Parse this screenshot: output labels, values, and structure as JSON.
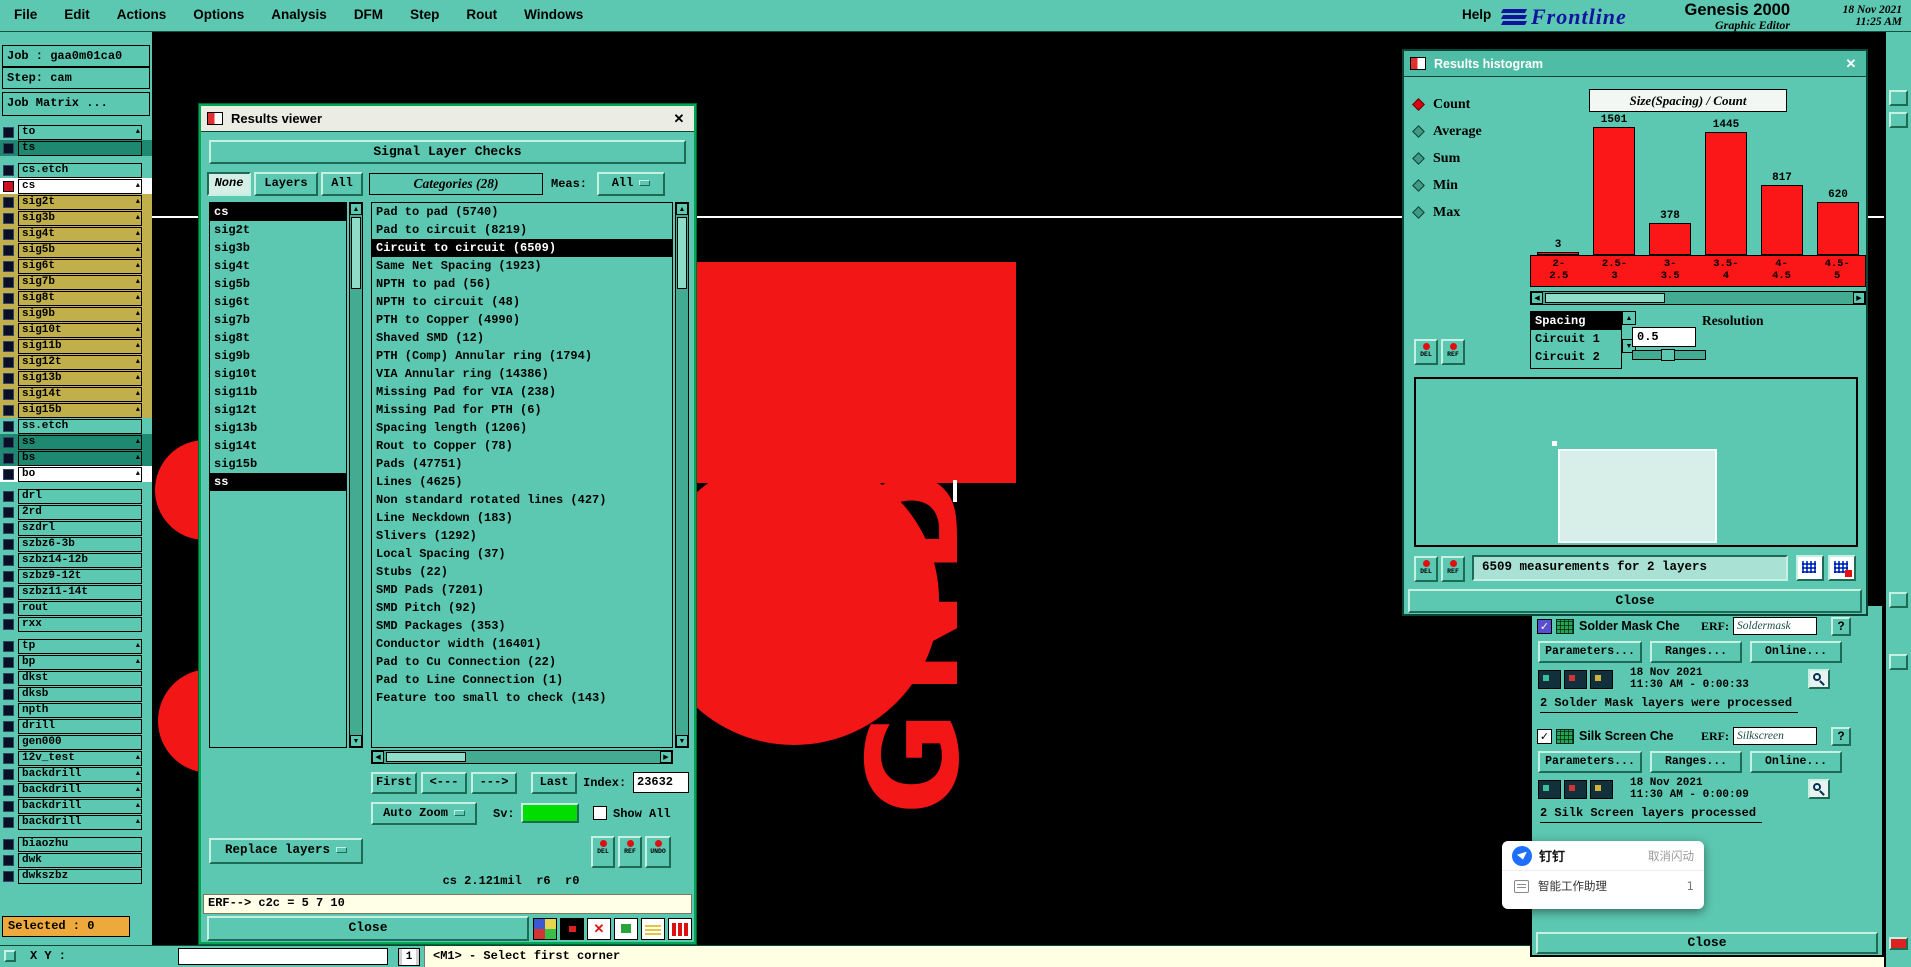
{
  "colors": {
    "teal": "#5cc8b1",
    "canvas_red": "#f31616",
    "yellow_row": "#c0af4b",
    "dark_row": "#1f8870",
    "orange_selected": "#eda93c",
    "swatch_green": "#00dd00",
    "brand_navy": "#12129e",
    "bar_red": "#fb1717"
  },
  "menu": {
    "items": [
      "File",
      "Edit",
      "Actions",
      "Options",
      "Analysis",
      "DFM",
      "Step",
      "Rout",
      "Windows"
    ],
    "help": "Help",
    "brand": "Frontline",
    "product": "Genesis 2000",
    "edition": "Graphic Editor",
    "date": "18 Nov 2021",
    "time": "11:25 AM"
  },
  "sidebar": {
    "job": "Job : gaa0m01ca0",
    "step": "Step: cam",
    "matrix_button": "Job Matrix ...",
    "selected": "Selected : 0",
    "layers": [
      {
        "name": "to",
        "bg": "teal",
        "arrow": true
      },
      {
        "name": "ts",
        "bg": "dark"
      },
      {
        "name": "cs.etch",
        "bg": "teal",
        "gap": true
      },
      {
        "name": "cs",
        "bg": "white",
        "arrow": true,
        "mark": "red"
      },
      {
        "name": "sig2t",
        "bg": "yellow",
        "arrow": true
      },
      {
        "name": "sig3b",
        "bg": "yellow",
        "arrow": true
      },
      {
        "name": "sig4t",
        "bg": "yellow",
        "arrow": true
      },
      {
        "name": "sig5b",
        "bg": "yellow",
        "arrow": true
      },
      {
        "name": "sig6t",
        "bg": "yellow",
        "arrow": true
      },
      {
        "name": "sig7b",
        "bg": "yellow",
        "arrow": true
      },
      {
        "name": "sig8t",
        "bg": "yellow",
        "arrow": true
      },
      {
        "name": "sig9b",
        "bg": "yellow",
        "arrow": true
      },
      {
        "name": "sig10t",
        "bg": "yellow",
        "arrow": true
      },
      {
        "name": "sig11b",
        "bg": "yellow",
        "arrow": true
      },
      {
        "name": "sig12t",
        "bg": "yellow",
        "arrow": true
      },
      {
        "name": "sig13b",
        "bg": "yellow",
        "arrow": true
      },
      {
        "name": "sig14t",
        "bg": "yellow",
        "arrow": true
      },
      {
        "name": "sig15b",
        "bg": "yellow",
        "arrow": true
      },
      {
        "name": "ss.etch",
        "bg": "teal"
      },
      {
        "name": "ss",
        "bg": "dark",
        "arrow": true
      },
      {
        "name": "bs",
        "bg": "dark",
        "arrow": true
      },
      {
        "name": "bo",
        "bg": "white",
        "arrow": true
      },
      {
        "name": "drl",
        "bg": "teal",
        "gap": true
      },
      {
        "name": "2rd",
        "bg": "teal"
      },
      {
        "name": "szdrl",
        "bg": "teal"
      },
      {
        "name": "szbz6-3b",
        "bg": "teal"
      },
      {
        "name": "szbz14-12b",
        "bg": "teal"
      },
      {
        "name": "szbz9-12t",
        "bg": "teal"
      },
      {
        "name": "szbz11-14t",
        "bg": "teal"
      },
      {
        "name": "rout",
        "bg": "teal"
      },
      {
        "name": "rxx",
        "bg": "teal"
      },
      {
        "name": "tp",
        "bg": "teal",
        "arrow": true,
        "gap": true
      },
      {
        "name": "bp",
        "bg": "teal",
        "arrow": true
      },
      {
        "name": "dkst",
        "bg": "teal"
      },
      {
        "name": "dksb",
        "bg": "teal"
      },
      {
        "name": "npth",
        "bg": "teal"
      },
      {
        "name": "drill",
        "bg": "teal"
      },
      {
        "name": "gen000",
        "bg": "teal"
      },
      {
        "name": "12v_test",
        "bg": "teal",
        "arrow": true
      },
      {
        "name": "backdrill",
        "bg": "teal",
        "arrow": true
      },
      {
        "name": "backdrill",
        "bg": "teal",
        "arrow": true
      },
      {
        "name": "backdrill",
        "bg": "teal",
        "arrow": true
      },
      {
        "name": "backdrill",
        "bg": "teal",
        "arrow": true
      },
      {
        "name": "biaozhu",
        "bg": "teal",
        "gap": true
      },
      {
        "name": "dwk",
        "bg": "teal"
      },
      {
        "name": "dwkszbz",
        "bg": "teal"
      }
    ]
  },
  "canvas": {
    "gnd_text": "GND"
  },
  "status_bar": {
    "xy_label": "X Y :",
    "layer_indicator": "1",
    "message": "<M1> - Select first corner"
  },
  "results_viewer": {
    "title": "Results viewer",
    "header": "Signal Layer Checks",
    "filter_none": "None",
    "filter_layers": "Layers",
    "filter_all": "All",
    "categories_label": "Categories (28)",
    "meas_label": "Meas:",
    "meas_value": "All",
    "layers": [
      {
        "name": "cs",
        "selected": true
      },
      {
        "name": "sig2t"
      },
      {
        "name": "sig3b"
      },
      {
        "name": "sig4t"
      },
      {
        "name": "sig5b"
      },
      {
        "name": "sig6t"
      },
      {
        "name": "sig7b"
      },
      {
        "name": "sig8t"
      },
      {
        "name": "sig9b"
      },
      {
        "name": "sig10t"
      },
      {
        "name": "sig11b"
      },
      {
        "name": "sig12t"
      },
      {
        "name": "sig13b"
      },
      {
        "name": "sig14t"
      },
      {
        "name": "sig15b"
      },
      {
        "name": "ss",
        "selected": true
      }
    ],
    "categories": [
      {
        "label": "Pad to pad (5740)"
      },
      {
        "label": "Pad to circuit (8219)"
      },
      {
        "label": "Circuit to circuit (6509)",
        "selected": true
      },
      {
        "label": "Same Net Spacing (1923)"
      },
      {
        "label": "NPTH to pad (56)"
      },
      {
        "label": "NPTH to circuit (48)"
      },
      {
        "label": "PTH to Copper (4990)"
      },
      {
        "label": "Shaved SMD (12)"
      },
      {
        "label": "PTH (Comp) Annular ring (1794)"
      },
      {
        "label": "VIA Annular ring (14386)"
      },
      {
        "label": "Missing Pad for VIA (238)"
      },
      {
        "label": "Missing Pad for PTH (6)"
      },
      {
        "label": "Spacing length (1206)"
      },
      {
        "label": "Rout to Copper (78)"
      },
      {
        "label": "Pads (47751)"
      },
      {
        "label": "Lines (4625)"
      },
      {
        "label": "Non standard rotated lines (427)"
      },
      {
        "label": "Line Neckdown (183)"
      },
      {
        "label": "Slivers (1292)"
      },
      {
        "label": "Local Spacing (37)"
      },
      {
        "label": "Stubs (22)"
      },
      {
        "label": "SMD Pads (7201)"
      },
      {
        "label": "SMD Pitch (92)"
      },
      {
        "label": "SMD Packages (353)"
      },
      {
        "label": "Conductor width (16401)"
      },
      {
        "label": "Pad to Cu Connection (22)"
      },
      {
        "label": "Pad to Line Connection (1)"
      },
      {
        "label": "Feature too small to check (143)"
      }
    ],
    "nav_first": "First",
    "nav_prev": "<---",
    "nav_next": "--->",
    "nav_last": "Last",
    "index_label": "Index:",
    "index_value": "23632",
    "auto_zoom": "Auto Zoom",
    "sv_label": "Sv:",
    "show_all": "Show All",
    "del": "DEL",
    "ref": "REF",
    "undo": "UNDO",
    "replace_layers": "Replace layers",
    "status_line": "cs 2.121mil  r6  r0",
    "erf_line": "ERF--> c2c = 5 7 10",
    "close": "Close"
  },
  "histogram": {
    "title": "Results histogram",
    "stats": [
      {
        "label": "Count",
        "selected": true
      },
      {
        "label": "Average"
      },
      {
        "label": "Sum"
      },
      {
        "label": "Min"
      },
      {
        "label": "Max"
      }
    ],
    "chart_data": {
      "type": "bar",
      "title": "Size(Spacing) / Count",
      "categories": [
        "2-\n2.5",
        "2.5-\n3",
        "3-\n3.5",
        "3.5-\n4",
        "4-\n4.5",
        "4.5-\n5"
      ],
      "values": [
        3,
        1501,
        378,
        1445,
        817,
        620
      ],
      "ylim": [
        0,
        1501
      ],
      "bar_color": "#fb1717",
      "band_color": "#fb1717"
    },
    "selector": [
      {
        "label": "Spacing",
        "selected": true
      },
      {
        "label": "Circuit 1"
      },
      {
        "label": "Circuit 2"
      }
    ],
    "resolution_label": "Resolution",
    "resolution_value": "0.5",
    "del": "DEL",
    "ref": "REF",
    "measurements": "6509 measurements for 2 layers",
    "close": "Close"
  },
  "right_panel": {
    "erf_label": "ERF:",
    "help_label": "?",
    "buttons": [
      "Parameters...",
      "Ranges...",
      "Online..."
    ],
    "sections": [
      {
        "name": "Solder Mask Che",
        "erf_value": "Soldermask",
        "date": "18 Nov 2021",
        "time": "11:30 AM - 0:00:33",
        "status": "2 Solder Mask layers were processed"
      },
      {
        "name": "Silk Screen Che",
        "erf_value": "Silkscreen",
        "date": "18 Nov 2021",
        "time": "11:30 AM - 0:00:09",
        "status": "2 Silk Screen layers processed"
      }
    ],
    "close": "Close"
  },
  "popup": {
    "app_name": "钉钉",
    "dismiss_label": "取消闪动",
    "assistant_label": "智能工作助理",
    "badge": "1"
  }
}
